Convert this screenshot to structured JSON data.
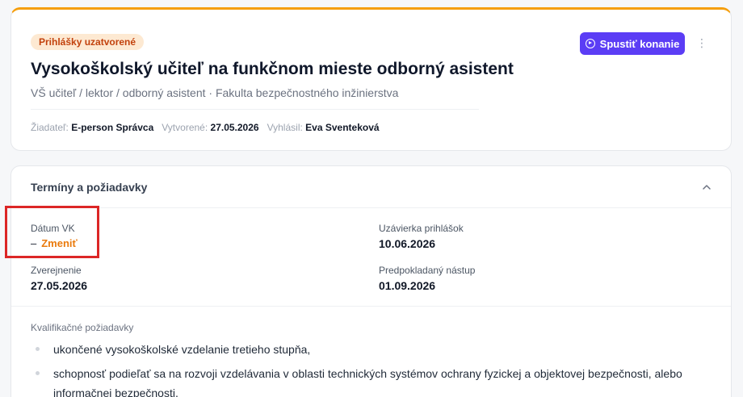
{
  "header": {
    "status_badge": "Prihlášky uzatvorené",
    "title": "Vysokoškolský učiteľ na funkčnom mieste odborný asistent",
    "subtitle": "VŠ učiteľ / lektor / odborný asistent · Fakulta bezpečnostného inžinierstva",
    "meta": {
      "applicant_label": "Žiadateľ:",
      "applicant_value": "E-person Správca",
      "created_label": "Vytvorené:",
      "created_value": "27.05.2026",
      "announced_label": "Vyhlásil:",
      "announced_value": "Eva Sventeková"
    },
    "start_button_label": "Spustiť konanie",
    "more_label": "⋮"
  },
  "terms": {
    "title": "Termíny a požiadavky",
    "date_vk": {
      "label": "Dátum VK",
      "value": "–",
      "change_label": "Zmeniť"
    },
    "deadline": {
      "label": "Uzávierka prihlášok",
      "value": "10.06.2026"
    },
    "published": {
      "label": "Zverejnenie",
      "value": "27.05.2026"
    },
    "expected_start": {
      "label": "Predpokladaný nástup",
      "value": "01.09.2026"
    },
    "qualifications_label": "Kvalifikačné požiadavky",
    "qualifications": [
      "ukončené vysokoškolské vzdelanie tretieho stupňa,",
      "schopnosť podieľať sa na rozvoji vzdelávania v oblasti technických systémov ochrany fyzickej a objektovej bezpečnosti, alebo informačnej bezpečnosti,"
    ]
  },
  "colors": {
    "accent_orange": "#f59e0b",
    "primary_button": "#5b3df5",
    "badge_bg": "#fde9d2",
    "badge_text": "#c2410c",
    "link_orange": "#ea7a0c",
    "highlight_red": "#dc2626"
  },
  "icons": [
    "play-circle-icon",
    "more-vertical-icon",
    "chevron-up-icon"
  ]
}
